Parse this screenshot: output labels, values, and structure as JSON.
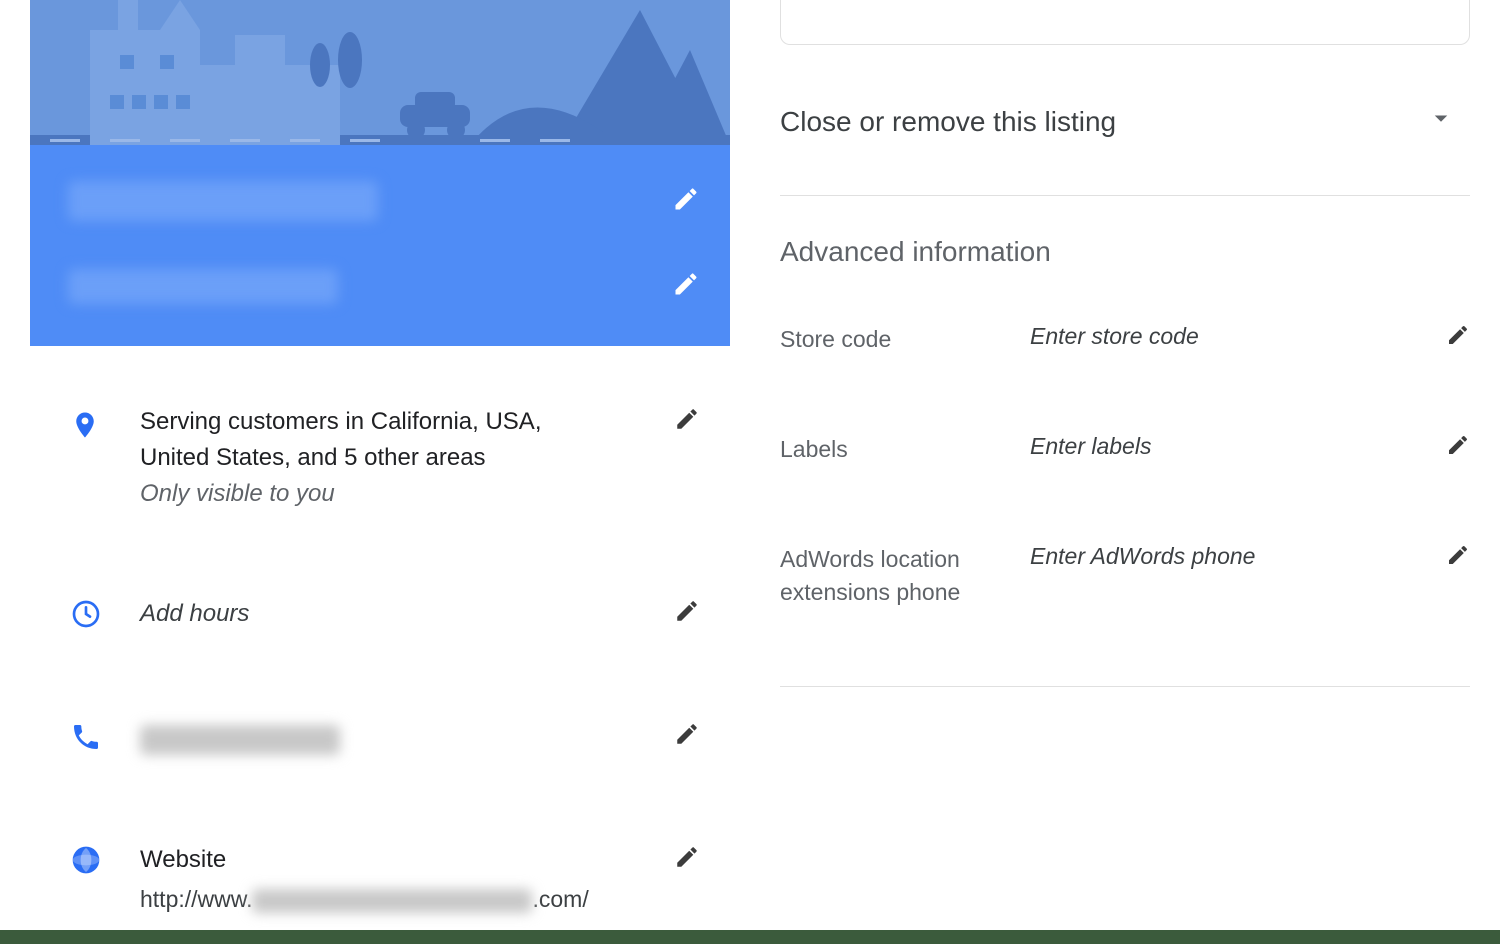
{
  "left": {
    "location": {
      "line1": "Serving customers in California, USA,",
      "line2": "United States, and 5 other areas",
      "visibility": "Only visible to you"
    },
    "hours_placeholder": "Add hours",
    "website": {
      "label": "Website",
      "url_prefix": "http://www.",
      "url_suffix": ".com/"
    }
  },
  "right": {
    "close_listing_label": "Close or remove this listing",
    "advanced_title": "Advanced information",
    "fields": [
      {
        "label": "Store code",
        "placeholder": "Enter store code"
      },
      {
        "label": "Labels",
        "placeholder": "Enter labels"
      },
      {
        "label": "AdWords location extensions phone",
        "placeholder": "Enter AdWords phone"
      }
    ]
  }
}
